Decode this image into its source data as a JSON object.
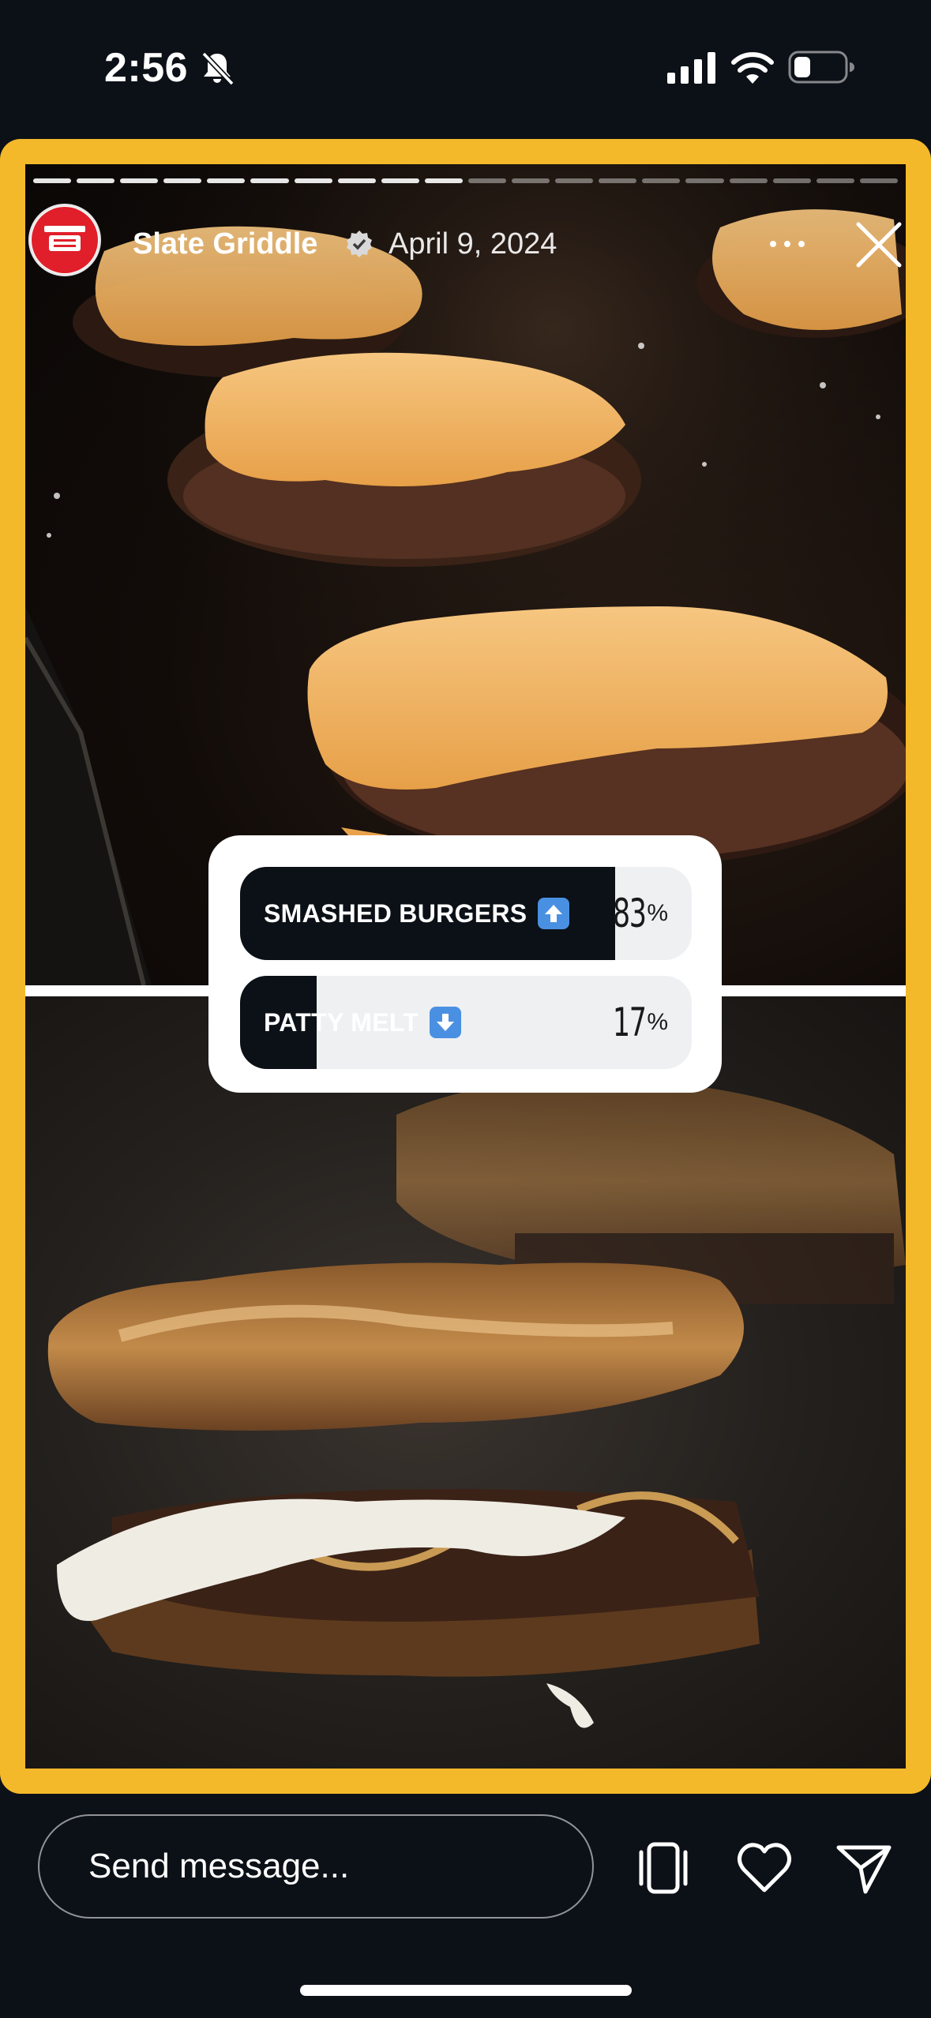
{
  "status_bar": {
    "time": "2:56",
    "icons": [
      "bell-slash-icon",
      "cellular-signal-icon",
      "wifi-icon",
      "battery-icon"
    ]
  },
  "story": {
    "progress_segments_total": 20,
    "progress_segments_viewed": 10,
    "username": "Slate Griddle",
    "verified": true,
    "date": "April 9, 2024",
    "accent_color": "#f3b92a",
    "photos": [
      "smashed-burgers-on-griddle",
      "patty-melt-on-griddle"
    ]
  },
  "poll": {
    "options": [
      {
        "label": "SMASHED BURGERS",
        "emoji": "up-arrow-emoji",
        "percent": 83,
        "percent_text": "83",
        "unit": "%"
      },
      {
        "label": "PATTY MELT",
        "emoji": "down-arrow-emoji",
        "percent": 17,
        "percent_text": "17",
        "unit": "%"
      }
    ]
  },
  "footer": {
    "message_placeholder": "Send message...",
    "icons": [
      "multi-photo-icon",
      "heart-icon",
      "send-icon"
    ]
  }
}
